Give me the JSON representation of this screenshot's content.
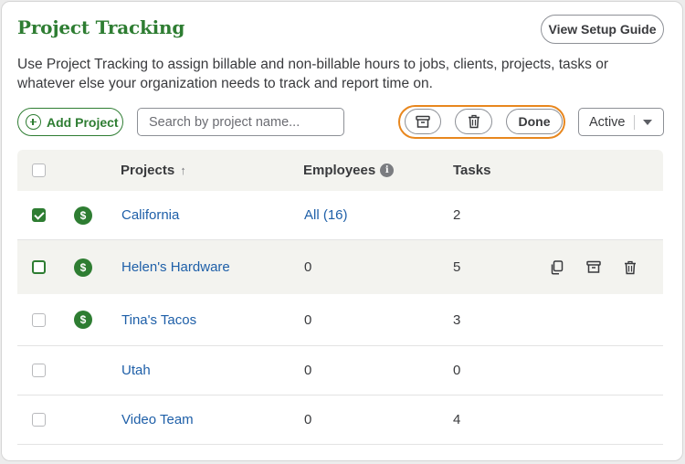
{
  "header": {
    "title": "Project Tracking",
    "guide_button": "View Setup Guide",
    "description": "Use Project Tracking to assign billable and non-billable hours to jobs, clients, projects, tasks or whatever else your organization needs to track and report time on."
  },
  "toolbar": {
    "add_project_label": "Add Project",
    "search_placeholder": "Search by project name...",
    "done_label": "Done",
    "status_value": "Active"
  },
  "table": {
    "columns": {
      "projects": "Projects",
      "employees": "Employees",
      "tasks": "Tasks"
    },
    "rows": [
      {
        "name": "California",
        "employees": "All (16)",
        "tasks": "2",
        "billable": true,
        "checked": true
      },
      {
        "name": "Helen's Hardware",
        "employees": "0",
        "tasks": "5",
        "billable": true,
        "checked": false
      },
      {
        "name": "Tina's Tacos",
        "employees": "0",
        "tasks": "3",
        "billable": true,
        "checked": false
      },
      {
        "name": "Utah",
        "employees": "0",
        "tasks": "0",
        "billable": false,
        "checked": false
      },
      {
        "name": "Video Team",
        "employees": "0",
        "tasks": "4",
        "billable": false,
        "checked": false
      }
    ]
  },
  "icons": {
    "billable": "dollar-icon",
    "sort": "arrow-up-icon",
    "info": "info-icon",
    "archive": "archive-icon",
    "delete": "trash-icon",
    "copy": "copy-icon"
  },
  "colors": {
    "brand_green": "#2e7d32",
    "link_blue": "#1e5fa8",
    "highlight_orange": "#e8871e"
  }
}
